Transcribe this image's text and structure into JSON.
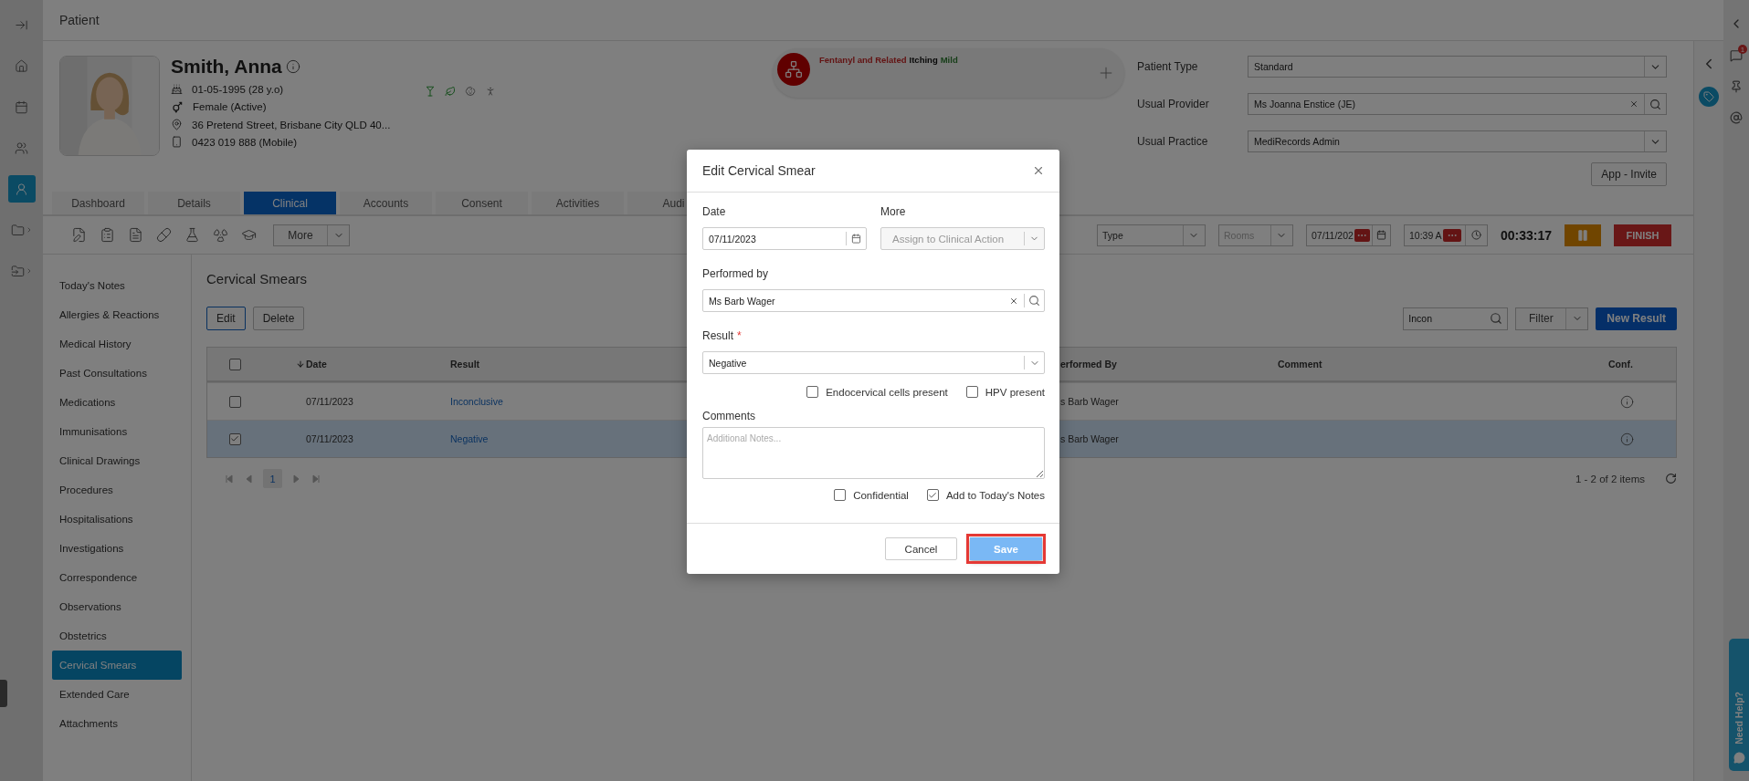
{
  "nav_rail": {
    "items": [
      {
        "selected": false,
        "expandable": false
      },
      {
        "selected": false,
        "expandable": false
      },
      {
        "selected": false,
        "expandable": false
      },
      {
        "selected": false,
        "expandable": false
      },
      {
        "selected": true,
        "expandable": false
      },
      {
        "selected": false,
        "expandable": true
      },
      {
        "selected": false,
        "expandable": true
      }
    ]
  },
  "page_title": "Patient",
  "patient": {
    "name": "Smith, Anna",
    "dob": "01-05-1995 (28 y.o)",
    "gender": "Female (Active)",
    "address": "36 Pretend Street, Brisbane City QLD 40...",
    "phone": "0423 019 888 (Mobile)"
  },
  "allergy": {
    "substance": "Fentanyl and Related",
    "reaction": "Itching",
    "severity": "Mild"
  },
  "details": [
    {
      "label": "Patient Type",
      "value": "Standard",
      "kind": "select"
    },
    {
      "label": "Usual Provider",
      "value": "Ms Joanna Enstice (JE)",
      "kind": "search"
    },
    {
      "label": "Usual Practice",
      "value": "MediRecords Admin",
      "kind": "select"
    }
  ],
  "app_invite": "App - Invite",
  "tabs": [
    {
      "label": "Dashboard",
      "selected": false
    },
    {
      "label": "Details",
      "selected": false
    },
    {
      "label": "Clinical",
      "selected": true
    },
    {
      "label": "Accounts",
      "selected": false
    },
    {
      "label": "Consent",
      "selected": false
    },
    {
      "label": "Activities",
      "selected": false
    },
    {
      "label": "Audi",
      "selected": false
    }
  ],
  "toolbar": {
    "more": "More",
    "type": {
      "placeholder": "Type",
      "disabled": false
    },
    "rooms": {
      "placeholder": "Rooms",
      "disabled": true
    },
    "date": "07/11/202",
    "time": "10:39 A",
    "timer": "00:33:17",
    "finish": "FINISH"
  },
  "sidebar": {
    "items": [
      {
        "label": "Today's Notes",
        "selected": false
      },
      {
        "label": "Allergies & Reactions",
        "selected": false
      },
      {
        "label": "Medical History",
        "selected": false
      },
      {
        "label": "Past Consultations",
        "selected": false
      },
      {
        "label": "Medications",
        "selected": false
      },
      {
        "label": "Immunisations",
        "selected": false
      },
      {
        "label": "Clinical Drawings",
        "selected": false
      },
      {
        "label": "Procedures",
        "selected": false
      },
      {
        "label": "Hospitalisations",
        "selected": false
      },
      {
        "label": "Investigations",
        "selected": false
      },
      {
        "label": "Correspondence",
        "selected": false
      },
      {
        "label": "Observations",
        "selected": false
      },
      {
        "label": "Obstetrics",
        "selected": false
      },
      {
        "label": "Cervical Smears",
        "selected": true
      },
      {
        "label": "Extended Care",
        "selected": false
      },
      {
        "label": "Attachments",
        "selected": false
      }
    ]
  },
  "section": {
    "title": "Cervical Smears",
    "actions": [
      {
        "label": "Edit",
        "selected": true
      },
      {
        "label": "Delete",
        "selected": false
      }
    ],
    "search": {
      "value": "Incon"
    },
    "filter": "Filter",
    "new_result": "New Result"
  },
  "table": {
    "all_checked": false,
    "columns": [
      {
        "label": "Date",
        "sorted": true
      },
      {
        "label": "Result",
        "sorted": false
      },
      {
        "label": "erformed By",
        "sorted": false
      },
      {
        "label": "Comment",
        "sorted": false
      },
      {
        "label": "Conf.",
        "sorted": false
      }
    ],
    "rows": [
      {
        "date": "07/11/2023",
        "result": "Inconclusive",
        "performed_by": "s Barb Wager",
        "checked": false,
        "selected": false
      },
      {
        "date": "07/11/2023",
        "result": "Negative",
        "performed_by": "s Barb Wager",
        "checked": true,
        "selected": true
      }
    ]
  },
  "pager": {
    "pages": [
      {
        "label": "1",
        "selected": true
      }
    ],
    "summary": "1 - 2 of 2 items"
  },
  "right_rail": {
    "notifications": "1"
  },
  "help_tab": "Need Help?",
  "modal": {
    "title": "Edit Cervical Smear",
    "date_label": "Date",
    "date": "07/11/2023",
    "more_label": "More",
    "more_placeholder": "Assign to Clinical Action",
    "more_disabled": true,
    "performed_label": "Performed by",
    "performed_value": "Ms Barb Wager",
    "result_label": "Result",
    "required_mark": "*",
    "result": "Negative",
    "flags": [
      {
        "label": "Endocervical cells present",
        "checked": false
      },
      {
        "label": "HPV present",
        "checked": false
      }
    ],
    "comments_label": "Comments",
    "comments_placeholder": "Additional Notes...",
    "options": [
      {
        "label": "Confidential",
        "checked": false
      },
      {
        "label": "Add to Today's Notes",
        "checked": true
      }
    ],
    "cancel": "Cancel",
    "save": "Save",
    "save_highlighted": true
  }
}
